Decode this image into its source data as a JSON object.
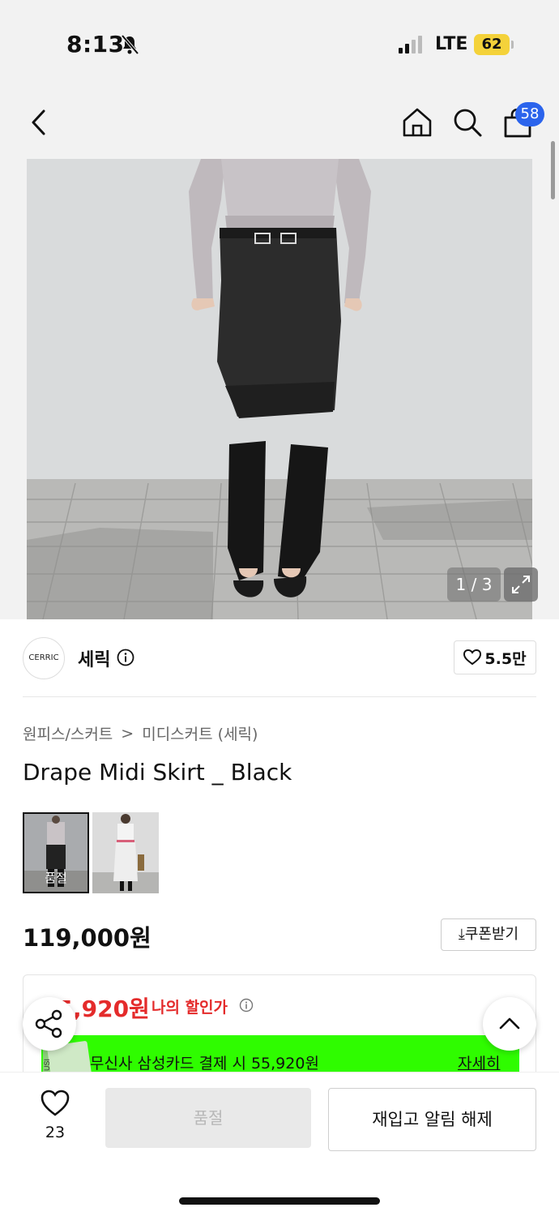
{
  "status": {
    "time": "8:13",
    "network": "LTE",
    "battery": "62"
  },
  "nav": {
    "cart_count": "58"
  },
  "gallery": {
    "counter": "1 / 3"
  },
  "brand": {
    "logo_text": "CERRIC",
    "name": "세릭",
    "likes": "5.5만"
  },
  "breadcrumb": {
    "category": "원피스/스커트",
    "separator": ">",
    "subcategory": "미디스커트 (세릭)"
  },
  "product": {
    "title": "Drape Midi Skirt _ Black",
    "price": "119,000원",
    "thumb_soldout": "품절"
  },
  "coupon": {
    "label": "쿠폰받기"
  },
  "discount": {
    "my_price": "55,920원",
    "my_price_label": "나의 할인가",
    "card_offer": "무신사 삼성카드 결제 시 55,920원",
    "card_detail": "자세히",
    "banner_color": "#2ffc00"
  },
  "bottom": {
    "wish_count": "23",
    "soldout_label": "품절",
    "restock_label": "재입고 알림 해제"
  },
  "colors": {
    "accent_red": "#e42b2b",
    "badge_blue": "#2b64ec"
  }
}
